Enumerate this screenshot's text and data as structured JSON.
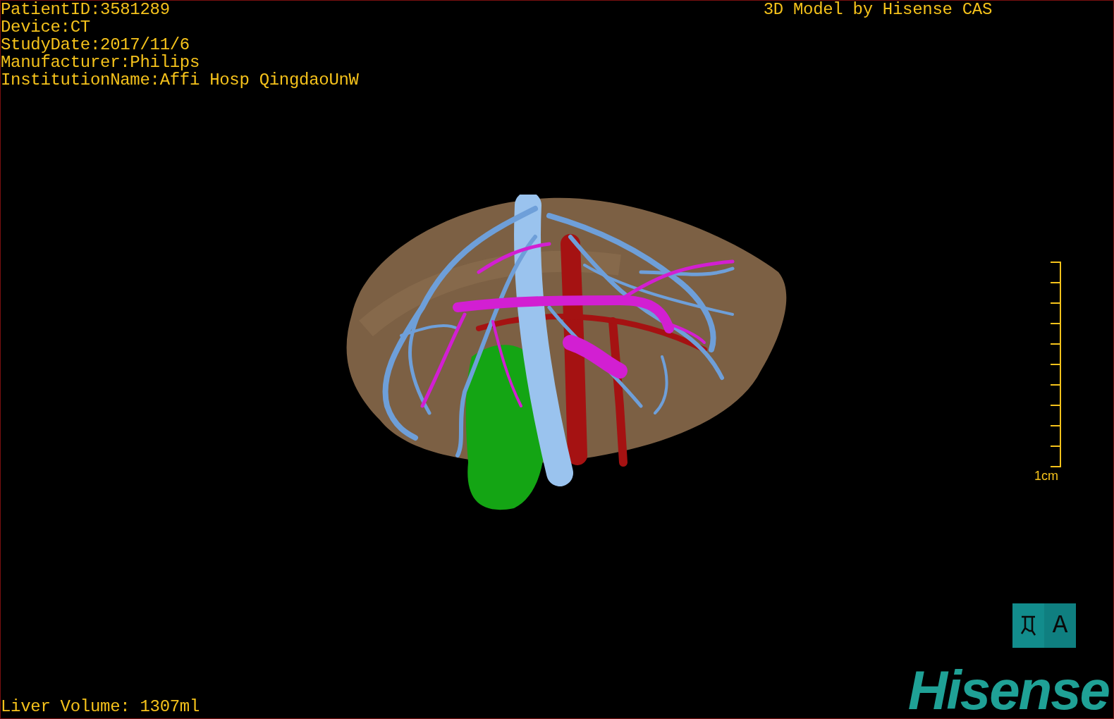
{
  "info_lines": [
    "PatientID:3581289",
    "Device:CT",
    "StudyDate:2017/11/6",
    "Manufacturer:Philips",
    "InstitutionName:Affi Hosp QingdaoUnW"
  ],
  "title": "3D Model by Hisense CAS",
  "scale_bar": {
    "label": "1cm"
  },
  "orientation": {
    "label": "A"
  },
  "liver_volume": "Liver Volume: 1307ml",
  "logo": "Hisense"
}
